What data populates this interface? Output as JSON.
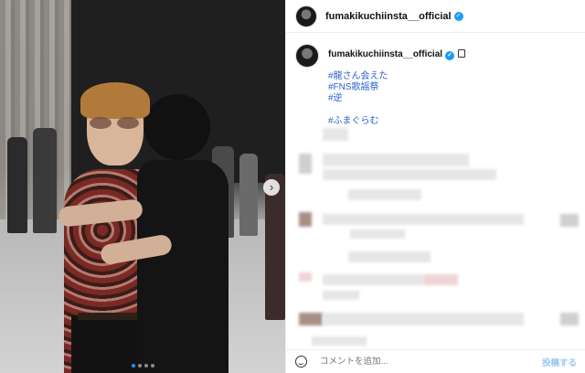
{
  "header": {
    "username": "fumakikuchiinsta__official"
  },
  "caption": {
    "username": "fumakikuchiinsta__official",
    "hashtags": [
      "#龍さん会えた",
      "#FNS歌謡祭",
      "#逆"
    ],
    "hashtag_extra": "#ふまぐらむ"
  },
  "footer": {
    "comment_placeholder": "コメントを追加...",
    "post_label": "投稿する"
  },
  "carousel": {
    "slide_count": 4,
    "active_index": 0
  },
  "colors": {
    "hashtag": "#2a62c9",
    "verified": "#1d9bf0",
    "active_dot": "#2b8cff"
  },
  "icons": [
    "verified-badge-icon",
    "lock-icon",
    "next-arrow-icon",
    "emoji-icon"
  ]
}
